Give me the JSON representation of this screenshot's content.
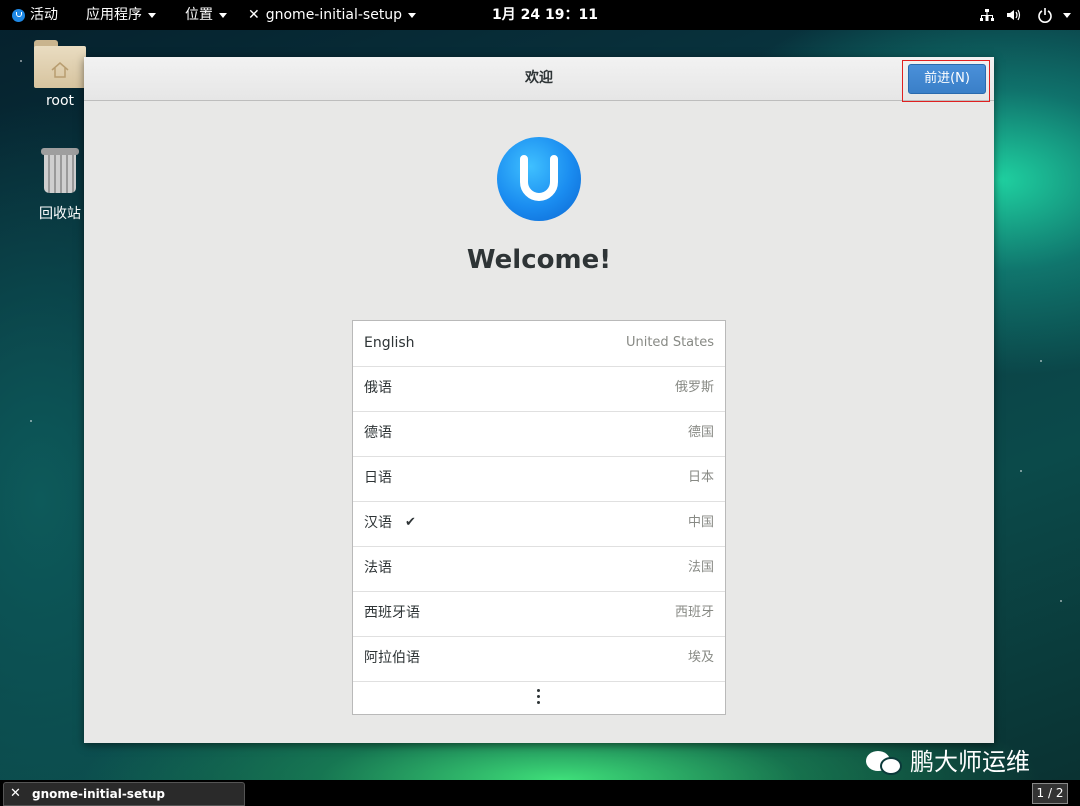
{
  "topbar": {
    "activities": "活动",
    "applications": "应用程序",
    "places": "位置",
    "app_menu": "gnome-initial-setup",
    "clock": "1月 24 19：11"
  },
  "desktop": {
    "icons": [
      {
        "label": "root",
        "icon": "home-folder-icon"
      },
      {
        "label": "回收站",
        "icon": "trash-icon"
      }
    ]
  },
  "window": {
    "title": "欢迎",
    "next_button": "前进(N)",
    "welcome": "Welcome!",
    "languages": [
      {
        "name": "English",
        "region": "United States",
        "selected": false
      },
      {
        "name": "俄语",
        "region": "俄罗斯",
        "selected": false
      },
      {
        "name": "德语",
        "region": "德国",
        "selected": false
      },
      {
        "name": "日语",
        "region": "日本",
        "selected": false
      },
      {
        "name": "汉语",
        "region": "中国",
        "selected": true,
        "check": "✔"
      },
      {
        "name": "法语",
        "region": "法国",
        "selected": false
      },
      {
        "name": "西班牙语",
        "region": "西班牙",
        "selected": false
      },
      {
        "name": "阿拉伯语",
        "region": "埃及",
        "selected": false
      }
    ]
  },
  "taskbar": {
    "task": "gnome-initial-setup",
    "workspace": "1 / 2"
  },
  "watermark": "鹏大师运维",
  "colors": {
    "accent": "#3a7fc8",
    "topbar": "#000000",
    "window_bg": "#e8e8e7"
  }
}
